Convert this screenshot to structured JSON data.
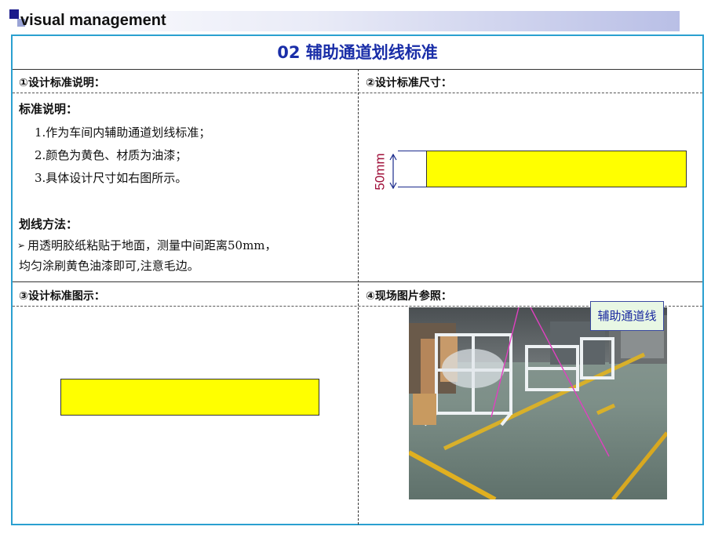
{
  "header": {
    "title": "visual management"
  },
  "section": {
    "title": "02 辅助通道划线标准"
  },
  "cells": {
    "design_description": {
      "label": "①设计标准说明："
    },
    "design_size": {
      "label": "②设计标准尺寸：",
      "dimension_label": "50mm"
    },
    "design_diagram": {
      "label": "③设计标准图示："
    },
    "site_photo": {
      "label": "④现场图片参照：",
      "callout": "辅助通道线"
    }
  },
  "description": {
    "standard_heading": "标准说明：",
    "items": [
      "1.作为车间内辅助通道划线标准；",
      "2.颜色为黄色、材质为油漆；",
      "3.具体设计尺寸如右图所示。"
    ],
    "method_heading": "划线方法：",
    "method_bullet": "➢",
    "method_line1": "用透明胶纸粘贴于地面，测量中间距离50mm，",
    "method_line2": "均匀涂刷黄色油漆即可,注意毛边。"
  },
  "colors": {
    "line_yellow": "#ffff00",
    "title_blue": "#1a2ea8",
    "frame_blue": "#2aa0d0"
  }
}
